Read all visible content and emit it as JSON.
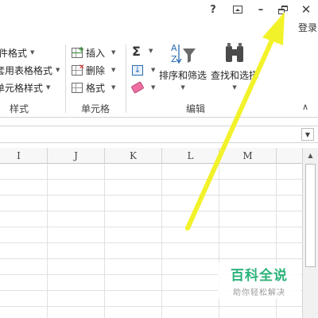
{
  "title_bar": {
    "help_label": "?",
    "minimize_label": "–",
    "close_label": "✕",
    "login_label": "登录"
  },
  "ribbon": {
    "styles_group": {
      "items": [
        "件格式",
        "套用表格格式",
        "单元格样式"
      ],
      "label": "样式"
    },
    "cells_group": {
      "insert_label": "插入",
      "delete_label": "删除",
      "format_label": "格式",
      "label": "单元格"
    },
    "editing_group": {
      "sort_filter_label": "排序和筛选",
      "find_select_label": "查找和选择",
      "label": "编辑"
    }
  },
  "columns": [
    "I",
    "J",
    "K",
    "L",
    "M"
  ],
  "watermark": {
    "main": "百科全说",
    "sub": "助你轻松解决"
  },
  "colors": {
    "arrow": "#f2f22a",
    "watermark_green": "#2db37a"
  }
}
